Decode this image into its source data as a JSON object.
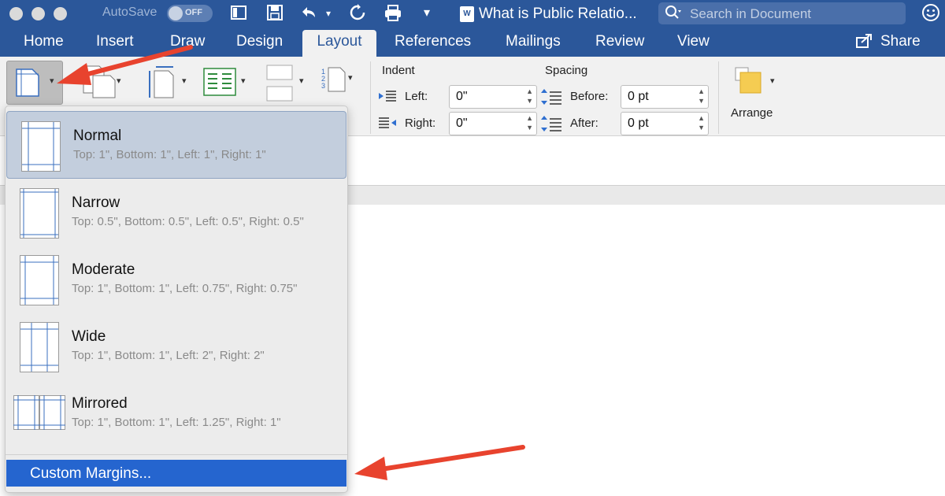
{
  "titlebar": {
    "autosave_label": "AutoSave",
    "autosave_state": "OFF",
    "doc_badge": "W",
    "document_title": "What is Public Relatio...",
    "search_placeholder": "Search in Document",
    "search_icon": "search-icon",
    "smiley_icon": "smiley-icon"
  },
  "tabs": [
    {
      "label": "Home"
    },
    {
      "label": "Insert"
    },
    {
      "label": "Draw"
    },
    {
      "label": "Design"
    },
    {
      "label": "Layout"
    },
    {
      "label": "References"
    },
    {
      "label": "Mailings"
    },
    {
      "label": "Review"
    },
    {
      "label": "View"
    }
  ],
  "share_label": "Share",
  "ribbon": {
    "indent_heading": "Indent",
    "indent_left_label": "Left:",
    "indent_left_value": "0\"",
    "indent_right_label": "Right:",
    "indent_right_value": "0\"",
    "spacing_heading": "Spacing",
    "spacing_before_label": "Before:",
    "spacing_before_value": "0 pt",
    "spacing_after_label": "After:",
    "spacing_after_value": "0 pt",
    "arrange_label": "Arrange"
  },
  "margins_menu": {
    "items": [
      {
        "name": "Normal",
        "desc": "Top: 1\", Bottom: 1\", Left: 1\", Right: 1\"",
        "selected": true
      },
      {
        "name": "Narrow",
        "desc": "Top: 0.5\", Bottom: 0.5\", Left: 0.5\", Right: 0.5\""
      },
      {
        "name": "Moderate",
        "desc": "Top: 1\", Bottom: 1\", Left: 0.75\", Right: 0.75\""
      },
      {
        "name": "Wide",
        "desc": "Top: 1\", Bottom: 1\", Left: 2\", Right: 2\""
      },
      {
        "name": "Mirrored",
        "desc": "Top: 1\", Bottom: 1\", Left: 1.25\", Right: 1\""
      }
    ],
    "custom_label": "Custom Margins..."
  },
  "colors": {
    "word_blue": "#2b579a",
    "selection_blue": "#2565cf",
    "arrow_red": "#e8432e"
  }
}
